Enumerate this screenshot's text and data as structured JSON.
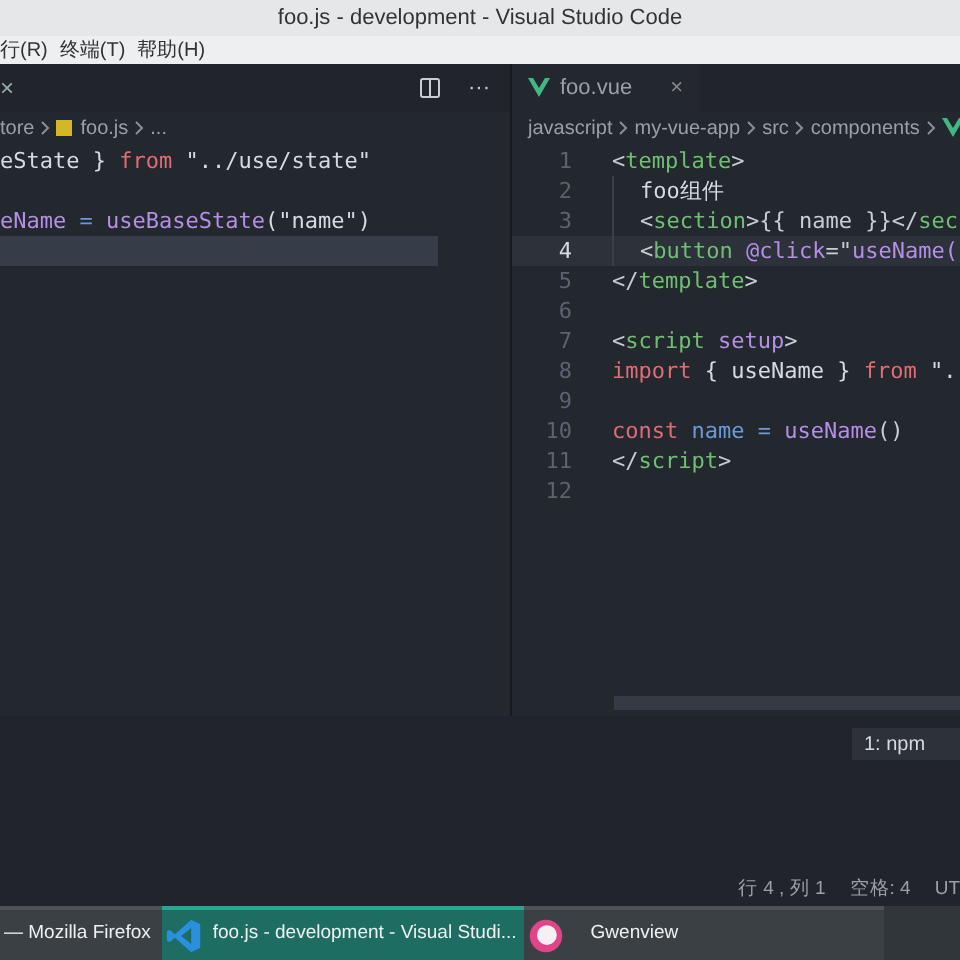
{
  "window": {
    "title": "foo.js - development - Visual Studio Code"
  },
  "menu": [
    "行(R)",
    "终端(T)",
    "帮助(H)"
  ],
  "left_editor": {
    "tab_close": "×",
    "more": "···",
    "breadcrumb": [
      "tore",
      "foo.js",
      "..."
    ],
    "lines": [
      {
        "current": false,
        "tokens": [
          {
            "t": "eState } ",
            "kind": "text"
          },
          {
            "t": "from",
            "kind": "keyword"
          },
          {
            "t": " \"../use/state\"",
            "kind": "text"
          }
        ]
      },
      {
        "current": false
      },
      {
        "current": false,
        "tokens": [
          {
            "t": "eName",
            "kind": "fn"
          },
          {
            "t": " = ",
            "kind": "var"
          },
          {
            "t": "useBaseState",
            "kind": "fn"
          },
          {
            "t": "(\"name\")",
            "kind": "text"
          }
        ]
      },
      {
        "current": true
      }
    ]
  },
  "right_editor": {
    "tab": {
      "label": "foo.vue",
      "close": "×"
    },
    "breadcrumb": [
      "javascript",
      "my-vue-app",
      "src",
      "components"
    ],
    "lines": [
      {
        "n": "1",
        "current": false,
        "indent": false,
        "tokens": [
          {
            "t": "<",
            "kind": "punct"
          },
          {
            "t": "template",
            "kind": "tag"
          },
          {
            "t": ">",
            "kind": "punct"
          }
        ]
      },
      {
        "n": "2",
        "current": false,
        "indent": true,
        "tokens": [
          {
            "t": "foo组件",
            "kind": "text"
          }
        ]
      },
      {
        "n": "3",
        "current": false,
        "indent": true,
        "tokens": [
          {
            "t": "<",
            "kind": "punct"
          },
          {
            "t": "section",
            "kind": "tag"
          },
          {
            "t": ">{{ name }}</",
            "kind": "punct"
          },
          {
            "t": "sec",
            "kind": "tag"
          }
        ]
      },
      {
        "n": "4",
        "current": true,
        "indent": true,
        "tokens": [
          {
            "t": "<",
            "kind": "punct"
          },
          {
            "t": "button",
            "kind": "tag"
          },
          {
            "t": " @click",
            "kind": "attr"
          },
          {
            "t": "=\"",
            "kind": "punct"
          },
          {
            "t": "useName(",
            "kind": "fn"
          }
        ]
      },
      {
        "n": "5",
        "current": false,
        "indent": false,
        "tokens": [
          {
            "t": "</",
            "kind": "punct"
          },
          {
            "t": "template",
            "kind": "tag"
          },
          {
            "t": ">",
            "kind": "punct"
          }
        ]
      },
      {
        "n": "6",
        "current": false,
        "indent": false
      },
      {
        "n": "7",
        "current": false,
        "indent": false,
        "tokens": [
          {
            "t": "<",
            "kind": "punct"
          },
          {
            "t": "script",
            "kind": "tag"
          },
          {
            "t": " setup",
            "kind": "attr"
          },
          {
            "t": ">",
            "kind": "punct"
          }
        ]
      },
      {
        "n": "8",
        "current": false,
        "indent": false,
        "tokens": [
          {
            "t": "import",
            "kind": "keyword"
          },
          {
            "t": " { useName } ",
            "kind": "text"
          },
          {
            "t": "from",
            "kind": "keyword"
          },
          {
            "t": " \".",
            "kind": "text"
          }
        ]
      },
      {
        "n": "9",
        "current": false,
        "indent": false
      },
      {
        "n": "10",
        "current": false,
        "indent": false,
        "tokens": [
          {
            "t": "const",
            "kind": "keyword"
          },
          {
            "t": " name",
            "kind": "var"
          },
          {
            "t": " = ",
            "kind": "var"
          },
          {
            "t": "useName",
            "kind": "fn"
          },
          {
            "t": "()",
            "kind": "punct"
          }
        ]
      },
      {
        "n": "11",
        "current": false,
        "indent": false,
        "tokens": [
          {
            "t": "</",
            "kind": "punct"
          },
          {
            "t": "script",
            "kind": "tag"
          },
          {
            "t": ">",
            "kind": "punct"
          }
        ]
      },
      {
        "n": "12",
        "current": false,
        "indent": false
      }
    ]
  },
  "terminal": {
    "selector": "1: npm"
  },
  "status_bar": [
    "行 4 , 列 1",
    "空格: 4",
    "UT"
  ],
  "taskbar": [
    {
      "label": "— Mozilla Firefox",
      "selected": false
    },
    {
      "label": "foo.js - development - Visual Studi...",
      "selected": true
    },
    {
      "label": "Gwenview",
      "selected": false
    }
  ]
}
